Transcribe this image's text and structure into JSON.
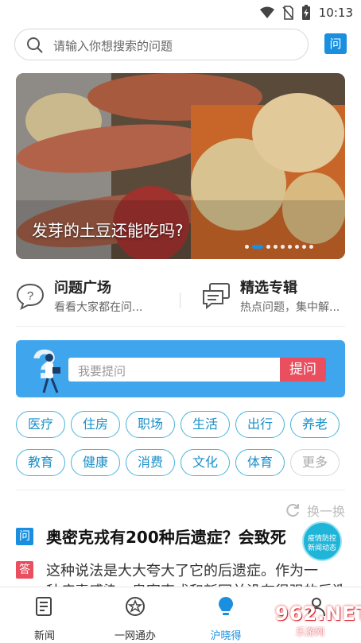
{
  "status": {
    "time": "10:13"
  },
  "search": {
    "placeholder": "请输入你想搜索的问题",
    "ask_icon_label": "问"
  },
  "banner": {
    "caption": "发芽的土豆还能吃吗?",
    "dot_count": 9,
    "active_dot": 1
  },
  "features": [
    {
      "title": "问题广场",
      "subtitle": "看看大家都在问..."
    },
    {
      "title": "精选专辑",
      "subtitle": "热点问题，集中解..."
    }
  ],
  "ask_card": {
    "placeholder": "我要提问",
    "button": "提问"
  },
  "tags": [
    "医疗",
    "住房",
    "职场",
    "生活",
    "出行",
    "养老",
    "教育",
    "健康",
    "消费",
    "文化",
    "体育",
    "更多"
  ],
  "refresh_label": "换一换",
  "question": {
    "badge": "问",
    "text": "奥密克戎有200种后遗症？会致死"
  },
  "answer": {
    "badge": "答",
    "line1": "这种说法是大大夸大了它的后遗症。作为一",
    "line2": "种病毒感染，奥密克戎和新冠并没有很强的后遗症"
  },
  "float_badge": {
    "line1": "疫情防控",
    "line2": "新闻动态"
  },
  "bottom_nav": [
    {
      "label": "新闻",
      "icon": "news-icon"
    },
    {
      "label": "一网通办",
      "icon": "service-icon"
    },
    {
      "label": "沪晓得",
      "icon": "bulb-icon",
      "active": true
    },
    {
      "label": "",
      "icon": "profile-icon"
    }
  ],
  "watermark": {
    "text": "962.NET",
    "sub": "乐游网"
  },
  "colors": {
    "accent": "#1a8fe0",
    "ask_button": "#e94f5e",
    "answer_badge": "#e94f5e",
    "tag_border": "#49b3d9"
  }
}
